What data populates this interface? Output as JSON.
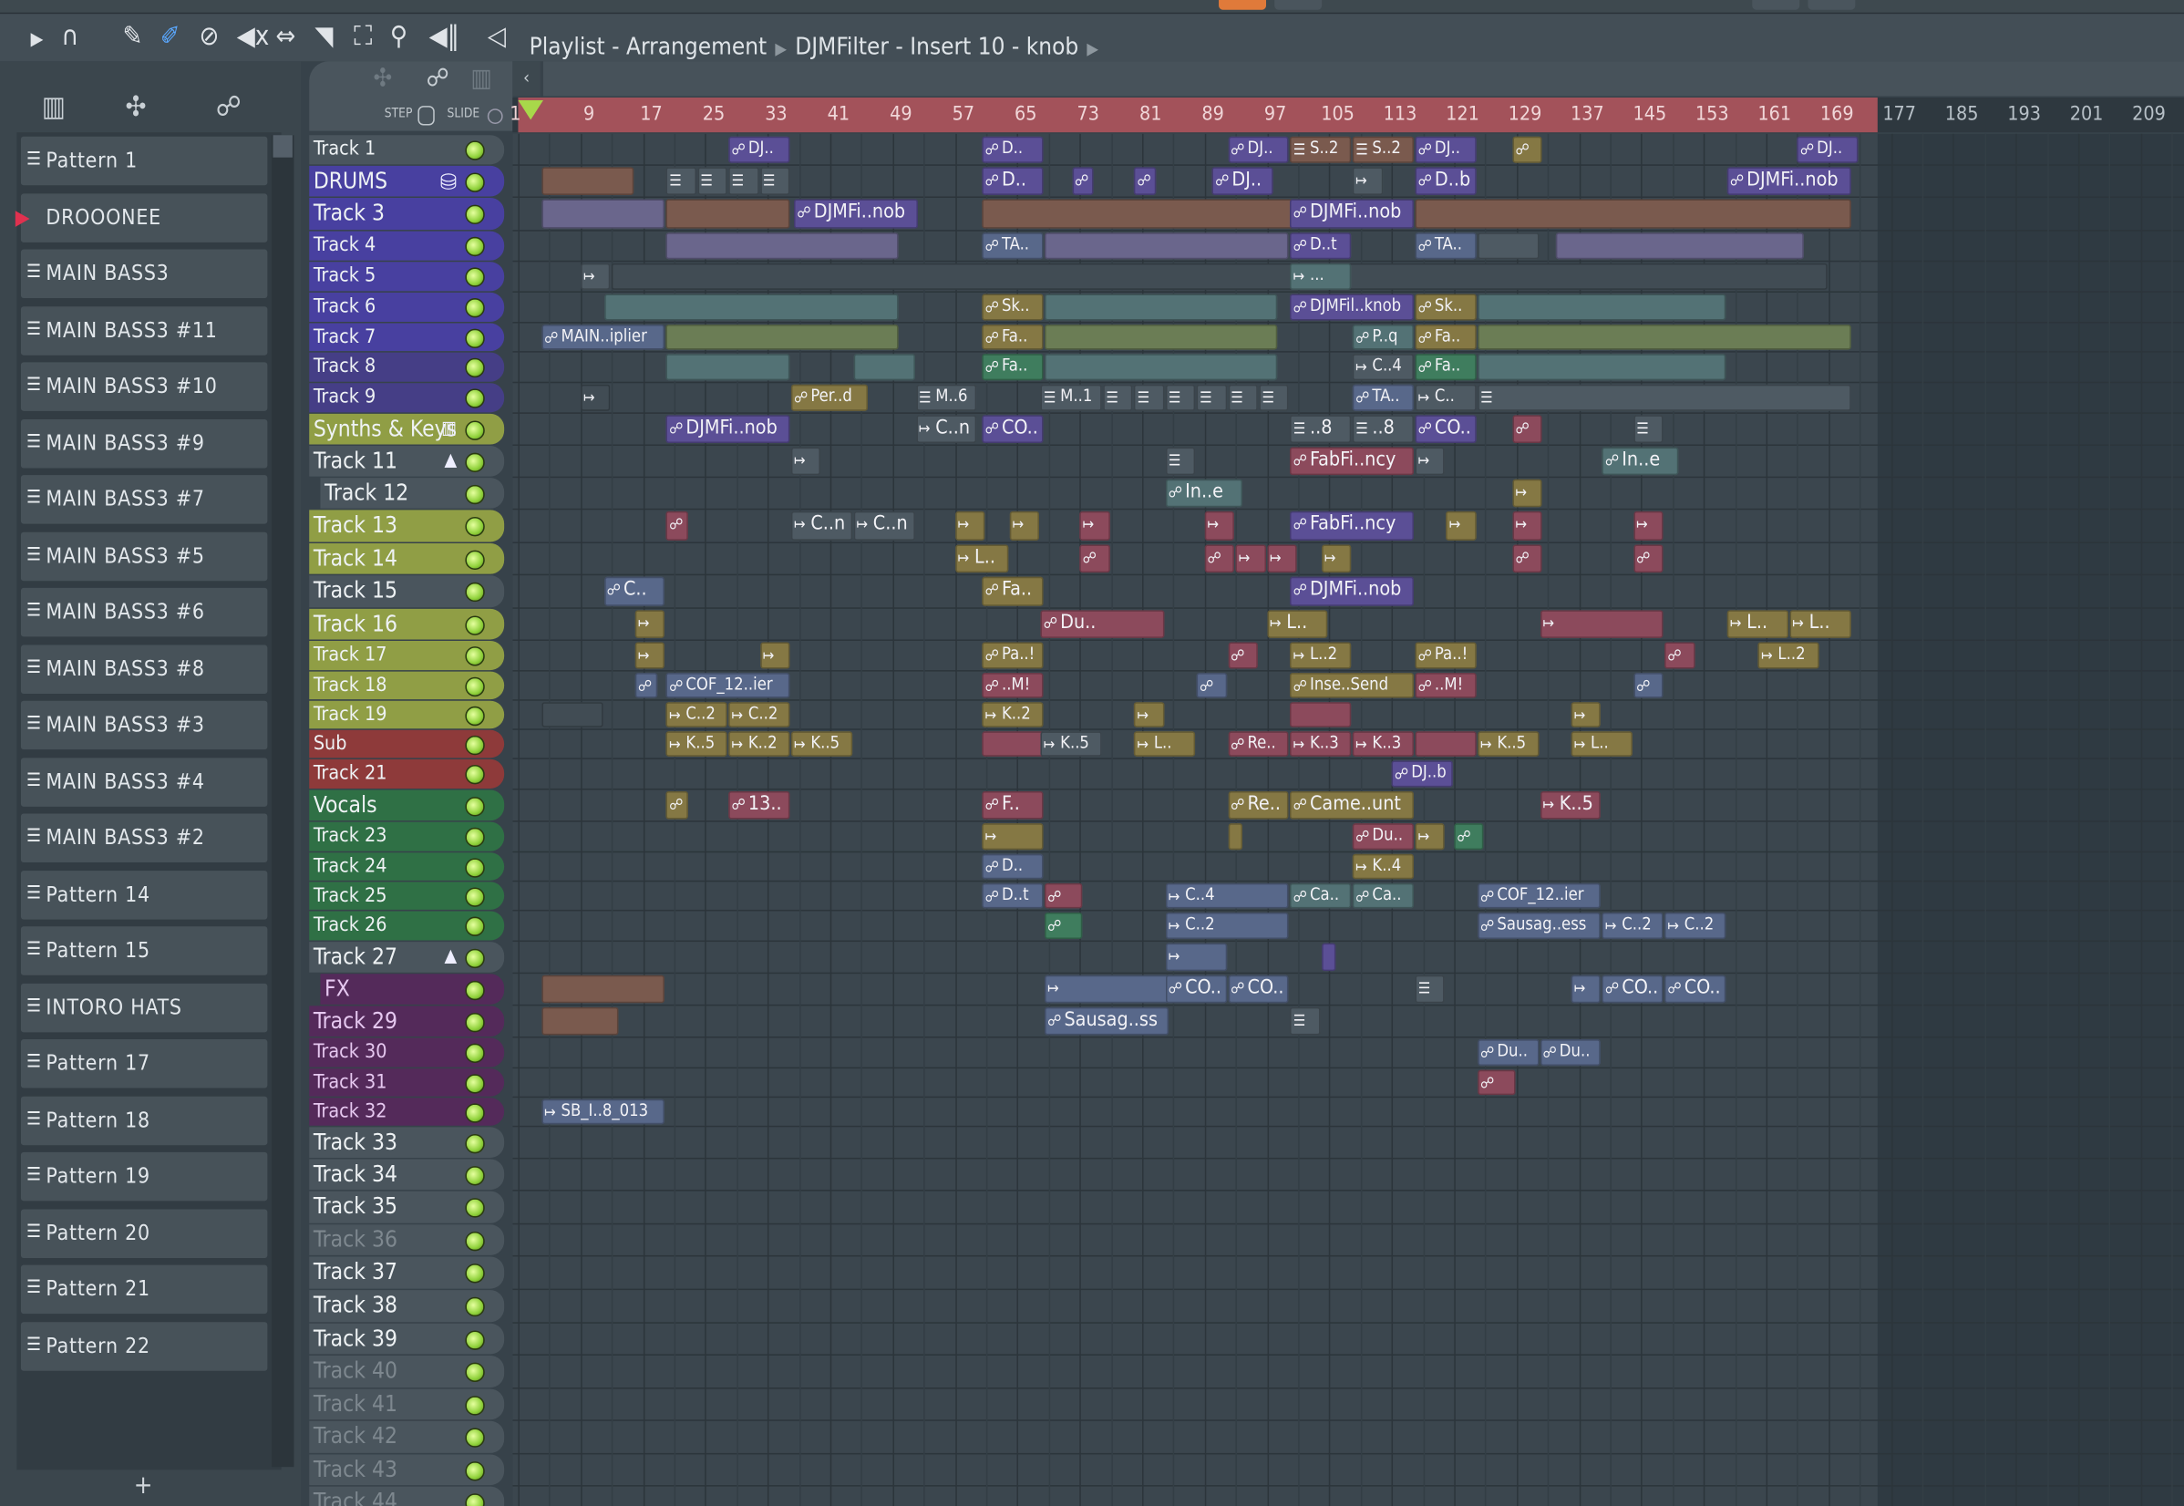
{
  "window": {
    "breadcrumb": [
      "Playlist - Arrangement",
      "DJMFilter - Insert 10 - knob"
    ]
  },
  "toolbar": {
    "icons": [
      "play-arrow-icon",
      "magnet-snap-icon",
      "pencil-icon",
      "paint-brush-icon",
      "delete-icon",
      "mute-icon",
      "slip-icon",
      "slice-icon",
      "select-icon",
      "zoom-icon",
      "playback-icon",
      "speaker-icon"
    ]
  },
  "panel": {
    "step_label": "STEP",
    "slide_label": "SLIDE",
    "add_label": "+"
  },
  "colors": {
    "ruler": "#a3525a",
    "led": "#8fd13a",
    "playhead": "#a8d84a",
    "accent_play": "#e0314f"
  },
  "patterns": [
    "Pattern 1",
    "DROOONEE",
    "MAIN BASS3",
    "MAIN BASS3 #11",
    "MAIN BASS3 #10",
    "MAIN BASS3 #9",
    "MAIN BASS3 #7",
    "MAIN BASS3 #5",
    "MAIN BASS3 #6",
    "MAIN BASS3 #8",
    "MAIN BASS3 #3",
    "MAIN BASS3 #4",
    "MAIN BASS3 #2",
    "Pattern 14",
    "Pattern 15",
    "INTORO HATS",
    "Pattern 17",
    "Pattern 18",
    "Pattern 19",
    "Pattern 20",
    "Pattern 21",
    "Pattern 22"
  ],
  "current_pattern": "DROOONEE",
  "ruler": [
    "1",
    "9",
    "17",
    "25",
    "33",
    "41",
    "49",
    "57",
    "65",
    "73",
    "81",
    "89",
    "97",
    "105",
    "113",
    "121",
    "129",
    "137",
    "145",
    "153",
    "161",
    "169",
    "177",
    "185",
    "193",
    "201",
    "209"
  ],
  "tracks": [
    {
      "name": "Track 1",
      "color": "#4a555d"
    },
    {
      "name": "DRUMS",
      "color": "#4840a0",
      "icon": "drum"
    },
    {
      "name": "Track 3",
      "color": "#4840a0"
    },
    {
      "name": "Track 4",
      "color": "#4840a0"
    },
    {
      "name": "Track 5",
      "color": "#4840a0"
    },
    {
      "name": "Track 6",
      "color": "#4840a0"
    },
    {
      "name": "Track 7",
      "color": "#4840a0"
    },
    {
      "name": "Track 8",
      "color": "#453e86"
    },
    {
      "name": "Track 9",
      "color": "#453e86"
    },
    {
      "name": "Synths & Keys",
      "color": "#909e45",
      "icon": "piano"
    },
    {
      "name": "Track 11",
      "color": "#4a555d",
      "icon": "collapse"
    },
    {
      "name": "Track 12",
      "color": "#4a555d"
    },
    {
      "name": "Track 13",
      "color": "#909e45"
    },
    {
      "name": "Track 14",
      "color": "#909e45"
    },
    {
      "name": "Track 15",
      "color": "#4a555d"
    },
    {
      "name": "Track 16",
      "color": "#909e45"
    },
    {
      "name": "Track 17",
      "color": "#909e45"
    },
    {
      "name": "Track 18",
      "color": "#909e45"
    },
    {
      "name": "Track 19",
      "color": "#909e45"
    },
    {
      "name": "Sub",
      "color": "#8e3a3a"
    },
    {
      "name": "Track 21",
      "color": "#8e3a3a"
    },
    {
      "name": "Vocals",
      "color": "#2f7045"
    },
    {
      "name": "Track 23",
      "color": "#2f7045"
    },
    {
      "name": "Track 24",
      "color": "#2f7045"
    },
    {
      "name": "Track 25",
      "color": "#2f7045"
    },
    {
      "name": "Track 26",
      "color": "#2f7045"
    },
    {
      "name": "Track 27",
      "color": "#4a555d",
      "icon": "collapse"
    },
    {
      "name": "FX",
      "color": "#542a5a"
    },
    {
      "name": "Track 29",
      "color": "#542a5a"
    },
    {
      "name": "Track 30",
      "color": "#542a5a"
    },
    {
      "name": "Track 31",
      "color": "#542a5a"
    },
    {
      "name": "Track 32",
      "color": "#542a5a"
    },
    {
      "name": "Track 33",
      "color": "#4a555d"
    },
    {
      "name": "Track 34",
      "color": "#4a555d"
    },
    {
      "name": "Track 35",
      "color": "#4a555d"
    },
    {
      "name": "Track 36",
      "color": "#4a555d",
      "dim": true
    },
    {
      "name": "Track 37",
      "color": "#4a555d"
    },
    {
      "name": "Track 38",
      "color": "#4a555d"
    },
    {
      "name": "Track 39",
      "color": "#4a555d"
    },
    {
      "name": "Track 40",
      "color": "#4a555d",
      "dim": true
    },
    {
      "name": "Track 41",
      "color": "#4a555d",
      "dim": true
    },
    {
      "name": "Track 42",
      "color": "#4a555d",
      "dim": true
    },
    {
      "name": "Track 43",
      "color": "#4a555d",
      "dim": true
    },
    {
      "name": "Track 44",
      "color": "#4a555d",
      "dim": true
    }
  ],
  "clip_colors": {
    "auto": "#5b4f96",
    "brown": "#7a5a4e",
    "lav": "#6a668c",
    "teal": "#537275",
    "gog": "#6b7d55",
    "olive": "#857844",
    "pink": "#8c4a5c",
    "green": "#3f7d5e",
    "gray": "#4e5a63",
    "slate": "#58688a",
    "dark": "#414c54"
  },
  "clips": [
    [
      0,
      28,
      8,
      "auto",
      "a",
      "DJ.."
    ],
    [
      0,
      60.5,
      8,
      "auto",
      "a",
      "D.."
    ],
    [
      0,
      92,
      8,
      "auto",
      "a",
      "DJ.."
    ],
    [
      0,
      100,
      8,
      "brown",
      "p",
      "S..2"
    ],
    [
      0,
      108,
      8,
      "brown",
      "p",
      "S..2"
    ],
    [
      0,
      116,
      8,
      "auto",
      "a",
      "DJ.."
    ],
    [
      0,
      128.5,
      4,
      "olive",
      "a",
      ""
    ],
    [
      0,
      165,
      8,
      "auto",
      "a",
      "DJ.."
    ],
    [
      1,
      4,
      12,
      "brown",
      "",
      ""
    ],
    [
      1,
      20,
      4,
      "gray",
      "p",
      ""
    ],
    [
      1,
      24,
      4,
      "gray",
      "p",
      ""
    ],
    [
      1,
      28,
      4,
      "gray",
      "p",
      ""
    ],
    [
      1,
      32,
      4,
      "gray",
      "p",
      ""
    ],
    [
      1,
      60.5,
      8,
      "auto",
      "a",
      "D.."
    ],
    [
      1,
      72,
      3,
      "auto",
      "a",
      ""
    ],
    [
      1,
      80,
      3,
      "auto",
      "a",
      ""
    ],
    [
      1,
      90,
      8,
      "auto",
      "a",
      "DJ.."
    ],
    [
      1,
      108,
      4,
      "gray",
      "w",
      ""
    ],
    [
      1,
      116,
      8,
      "auto",
      "a",
      "D..b"
    ],
    [
      1,
      156,
      16,
      "auto",
      "a",
      "DJMFi..nob"
    ],
    [
      2,
      4,
      16,
      "lav",
      "",
      ""
    ],
    [
      2,
      20,
      16,
      "brown",
      "",
      ""
    ],
    [
      2,
      36.4,
      16,
      "auto",
      "a",
      "DJMFi..nob"
    ],
    [
      2,
      60.5,
      40,
      "brown",
      "",
      ""
    ],
    [
      2,
      100,
      16,
      "auto",
      "a",
      "DJMFi..nob"
    ],
    [
      2,
      116,
      56,
      "brown",
      "",
      ""
    ],
    [
      3,
      20,
      30,
      "lav",
      "",
      ""
    ],
    [
      3,
      60.5,
      8,
      "slate",
      "a",
      "TA.."
    ],
    [
      3,
      68.5,
      31.5,
      "lav",
      "",
      ""
    ],
    [
      3,
      100,
      8,
      "auto",
      "a",
      "D..t"
    ],
    [
      3,
      116,
      8,
      "slate",
      "a",
      "TA.."
    ],
    [
      3,
      124,
      8,
      "gray",
      "",
      ""
    ],
    [
      3,
      134,
      32,
      "lav",
      "",
      ""
    ],
    [
      4,
      9,
      4,
      "gray",
      "w",
      ""
    ],
    [
      4,
      13,
      156,
      "dark",
      "",
      ""
    ],
    [
      4,
      100,
      8,
      "teal",
      "w",
      "..."
    ],
    [
      5,
      12,
      38,
      "teal",
      "",
      ""
    ],
    [
      5,
      60.5,
      8,
      "olive",
      "a",
      "Sk.."
    ],
    [
      5,
      68.5,
      30,
      "teal",
      "",
      ""
    ],
    [
      5,
      100,
      16,
      "auto",
      "a",
      "DJMFil..knob"
    ],
    [
      5,
      116,
      8,
      "olive",
      "a",
      "Sk.."
    ],
    [
      5,
      124,
      32,
      "teal",
      "",
      ""
    ],
    [
      6,
      4,
      16,
      "slate",
      "a",
      "MAIN..iplier"
    ],
    [
      6,
      20,
      30,
      "gog",
      "",
      ""
    ],
    [
      6,
      60.5,
      8,
      "olive",
      "a",
      "Fa.."
    ],
    [
      6,
      68.5,
      30,
      "gog",
      "",
      ""
    ],
    [
      6,
      108,
      8,
      "teal",
      "a",
      "P..q"
    ],
    [
      6,
      116,
      8,
      "olive",
      "a",
      "Fa.."
    ],
    [
      6,
      124,
      48,
      "gog",
      "",
      ""
    ],
    [
      7,
      20,
      16,
      "teal",
      "",
      ""
    ],
    [
      7,
      44,
      8,
      "teal",
      "",
      ""
    ],
    [
      7,
      60.5,
      8,
      "green",
      "a",
      "Fa.."
    ],
    [
      7,
      68.5,
      30,
      "teal",
      "",
      ""
    ],
    [
      7,
      108,
      8,
      "gray",
      "w",
      "C..4"
    ],
    [
      7,
      116,
      8,
      "green",
      "a",
      "Fa.."
    ],
    [
      7,
      124,
      32,
      "teal",
      "",
      ""
    ],
    [
      8,
      9,
      4,
      "dark",
      "w",
      ""
    ],
    [
      8,
      36,
      10,
      "olive",
      "a",
      "Per..d"
    ],
    [
      8,
      52,
      8,
      "gray",
      "p",
      "M..6"
    ],
    [
      8,
      68,
      8,
      "gray",
      "p",
      "M..1"
    ],
    [
      8,
      76,
      4,
      "gray",
      "p",
      ""
    ],
    [
      8,
      80,
      4,
      "gray",
      "p",
      ""
    ],
    [
      8,
      84,
      4,
      "gray",
      "p",
      ""
    ],
    [
      8,
      88,
      4,
      "gray",
      "p",
      ""
    ],
    [
      8,
      92,
      4,
      "gray",
      "p",
      ""
    ],
    [
      8,
      96,
      4,
      "gray",
      "p",
      ""
    ],
    [
      8,
      108,
      8,
      "slate",
      "a",
      "TA.."
    ],
    [
      8,
      116,
      8,
      "gray",
      "w",
      "C.."
    ],
    [
      8,
      124,
      48,
      "gray",
      "p",
      ""
    ],
    [
      9,
      20,
      16,
      "auto",
      "a",
      "DJMFi..nob"
    ],
    [
      9,
      52,
      8,
      "gray",
      "w",
      "C..n"
    ],
    [
      9,
      60.5,
      8,
      "auto",
      "a",
      "CO.."
    ],
    [
      9,
      100,
      8,
      "gray",
      "p",
      "..8"
    ],
    [
      9,
      108,
      8,
      "gray",
      "p",
      "..8"
    ],
    [
      9,
      116,
      8,
      "auto",
      "a",
      "CO.."
    ],
    [
      9,
      128.5,
      4,
      "pink",
      "a",
      ""
    ],
    [
      9,
      144,
      4,
      "gray",
      "p",
      ""
    ],
    [
      10,
      36,
      4,
      "gray",
      "w",
      ""
    ],
    [
      10,
      84,
      4,
      "gray",
      "p",
      ""
    ],
    [
      10,
      100,
      16,
      "pink",
      "a",
      "FabFi..ncy"
    ],
    [
      10,
      116,
      4,
      "gray",
      "w",
      ""
    ],
    [
      10,
      140,
      10,
      "teal",
      "a",
      "In..e"
    ],
    [
      11,
      84,
      10,
      "teal",
      "a",
      "In..e"
    ],
    [
      11,
      128.5,
      4,
      "olive",
      "w",
      ""
    ],
    [
      12,
      20,
      3,
      "pink",
      "a",
      ""
    ],
    [
      12,
      36,
      8,
      "gray",
      "w",
      "C..n"
    ],
    [
      12,
      44,
      8,
      "gray",
      "w",
      "C..n"
    ],
    [
      12,
      57,
      4,
      "olive",
      "w",
      ""
    ],
    [
      12,
      64,
      4,
      "olive",
      "w",
      ""
    ],
    [
      12,
      73,
      4,
      "pink",
      "w",
      ""
    ],
    [
      12,
      89,
      4,
      "pink",
      "w",
      ""
    ],
    [
      12,
      100,
      16,
      "auto",
      "a",
      "FabFi..ncy"
    ],
    [
      12,
      120,
      4,
      "olive",
      "w",
      ""
    ],
    [
      12,
      128.5,
      4,
      "pink",
      "w",
      ""
    ],
    [
      12,
      144,
      4,
      "pink",
      "w",
      ""
    ],
    [
      13,
      57,
      7,
      "olive",
      "w",
      "L.."
    ],
    [
      13,
      73,
      4,
      "pink",
      "a",
      ""
    ],
    [
      13,
      89,
      4,
      "pink",
      "a",
      ""
    ],
    [
      13,
      93,
      4,
      "pink",
      "w",
      ""
    ],
    [
      13,
      97,
      4,
      "pink",
      "w",
      ""
    ],
    [
      13,
      104,
      4,
      "olive",
      "w",
      ""
    ],
    [
      13,
      128.5,
      4,
      "pink",
      "a",
      ""
    ],
    [
      13,
      144,
      4,
      "pink",
      "a",
      ""
    ],
    [
      14,
      12,
      8,
      "slate",
      "a",
      "C.."
    ],
    [
      14,
      60.5,
      8,
      "olive",
      "a",
      "Fa.."
    ],
    [
      14,
      100,
      16,
      "auto",
      "a",
      "DJMFi..nob"
    ],
    [
      15,
      16,
      4,
      "olive",
      "w",
      ""
    ],
    [
      15,
      68,
      16,
      "pink",
      "a",
      "Du.."
    ],
    [
      15,
      97,
      8,
      "olive",
      "w",
      "L.."
    ],
    [
      15,
      132,
      16,
      "pink",
      "w",
      ""
    ],
    [
      15,
      156,
      8,
      "olive",
      "w",
      "L.."
    ],
    [
      15,
      164,
      8,
      "olive",
      "w",
      "L.."
    ],
    [
      16,
      16,
      4,
      "olive",
      "w",
      ""
    ],
    [
      16,
      32,
      4,
      "olive",
      "w",
      ""
    ],
    [
      16,
      60.5,
      8,
      "olive",
      "a",
      "Pa..!"
    ],
    [
      16,
      92,
      4,
      "pink",
      "a",
      ""
    ],
    [
      16,
      100,
      8,
      "olive",
      "w",
      "L..2"
    ],
    [
      16,
      116,
      8,
      "olive",
      "a",
      "Pa..!"
    ],
    [
      16,
      148,
      4,
      "pink",
      "a",
      ""
    ],
    [
      16,
      160,
      8,
      "olive",
      "w",
      "L..2"
    ],
    [
      17,
      16,
      3,
      "slate",
      "a",
      ""
    ],
    [
      17,
      20,
      16,
      "slate",
      "a",
      "COF_12..ier"
    ],
    [
      17,
      60.5,
      8,
      "pink",
      "a",
      "..M!"
    ],
    [
      17,
      88,
      4,
      "slate",
      "a",
      ""
    ],
    [
      17,
      100,
      16,
      "olive",
      "a",
      "Inse..Send"
    ],
    [
      17,
      116,
      8,
      "pink",
      "a",
      "..M!"
    ],
    [
      17,
      144,
      4,
      "slate",
      "a",
      ""
    ],
    [
      18,
      4,
      8,
      "dark",
      "",
      ""
    ],
    [
      18,
      20,
      8,
      "olive",
      "w",
      "C..2"
    ],
    [
      18,
      28,
      8,
      "olive",
      "w",
      "C..2"
    ],
    [
      18,
      60.5,
      8,
      "olive",
      "w",
      "K..2"
    ],
    [
      18,
      80,
      4,
      "olive",
      "w",
      ""
    ],
    [
      18,
      100,
      8,
      "pink",
      "",
      ""
    ],
    [
      18,
      136,
      4,
      "olive",
      "w",
      ""
    ],
    [
      19,
      20,
      8,
      "olive",
      "w",
      "K..5"
    ],
    [
      19,
      28,
      8,
      "olive",
      "w",
      "K..2"
    ],
    [
      19,
      36,
      8,
      "olive",
      "w",
      "K..5"
    ],
    [
      19,
      60.5,
      8,
      "pink",
      "",
      ""
    ],
    [
      19,
      68,
      8,
      "gray",
      "w",
      "K..5"
    ],
    [
      19,
      80,
      8,
      "olive",
      "w",
      "L.."
    ],
    [
      19,
      92,
      8,
      "pink",
      "a",
      "Re.."
    ],
    [
      19,
      100,
      8,
      "pink",
      "w",
      "K..3"
    ],
    [
      19,
      108,
      8,
      "pink",
      "w",
      "K..3"
    ],
    [
      19,
      116,
      8,
      "pink",
      "",
      ""
    ],
    [
      19,
      124,
      8,
      "olive",
      "w",
      "K..5"
    ],
    [
      19,
      136,
      8,
      "olive",
      "w",
      "L.."
    ],
    [
      20,
      113,
      8,
      "auto",
      "a",
      "DJ..b"
    ],
    [
      21,
      20,
      3,
      "olive",
      "a",
      ""
    ],
    [
      21,
      28,
      8,
      "pink",
      "a",
      "13.."
    ],
    [
      21,
      60.5,
      8,
      "pink",
      "a",
      "F.."
    ],
    [
      21,
      92,
      8,
      "olive",
      "a",
      "Re.."
    ],
    [
      21,
      100,
      16,
      "olive",
      "a",
      "Came..unt"
    ],
    [
      21,
      132,
      8,
      "pink",
      "w",
      "K..5"
    ],
    [
      22,
      60.5,
      8,
      "olive",
      "w",
      ""
    ],
    [
      22,
      92,
      2,
      "olive",
      "",
      ""
    ],
    [
      22,
      108,
      8,
      "pink",
      "a",
      "Du.."
    ],
    [
      22,
      116,
      4,
      "olive",
      "w",
      ""
    ],
    [
      22,
      121,
      4,
      "green",
      "a",
      ""
    ],
    [
      23,
      60.5,
      8,
      "slate",
      "a",
      "D.."
    ],
    [
      23,
      108,
      8,
      "olive",
      "w",
      "K..4"
    ],
    [
      24,
      60.5,
      8,
      "slate",
      "a",
      "D..t"
    ],
    [
      24,
      68.5,
      5,
      "pink",
      "a",
      ""
    ],
    [
      24,
      84,
      16,
      "slate",
      "w",
      "C..4"
    ],
    [
      24,
      100,
      8,
      "teal",
      "a",
      "Ca.."
    ],
    [
      24,
      108,
      8,
      "teal",
      "a",
      "Ca.."
    ],
    [
      24,
      124,
      16,
      "slate",
      "a",
      "COF_12..ier"
    ],
    [
      25,
      68.5,
      5,
      "green",
      "a",
      ""
    ],
    [
      25,
      84,
      16,
      "slate",
      "w",
      "C..2"
    ],
    [
      25,
      124,
      16,
      "slate",
      "a",
      "Sausag..ess"
    ],
    [
      25,
      140,
      8,
      "slate",
      "w",
      "C..2"
    ],
    [
      25,
      148,
      8,
      "slate",
      "w",
      "C..2"
    ],
    [
      26,
      84,
      8,
      "slate",
      "w",
      ""
    ],
    [
      26,
      104,
      2,
      "auto",
      "",
      ""
    ],
    [
      27,
      4,
      16,
      "brown",
      "",
      ""
    ],
    [
      27,
      68.5,
      16,
      "slate",
      "w",
      ""
    ],
    [
      27,
      84,
      8,
      "slate",
      "a",
      "CO.."
    ],
    [
      27,
      92,
      8,
      "slate",
      "a",
      "CO.."
    ],
    [
      27,
      116,
      4,
      "gray",
      "p",
      ""
    ],
    [
      27,
      136,
      4,
      "slate",
      "w",
      ""
    ],
    [
      27,
      140,
      8,
      "slate",
      "a",
      "CO.."
    ],
    [
      27,
      148,
      8,
      "slate",
      "a",
      "CO.."
    ],
    [
      28,
      4,
      10,
      "brown",
      "",
      ""
    ],
    [
      28,
      68.5,
      16,
      "slate",
      "a",
      "Sausag..ss"
    ],
    [
      28,
      100,
      4,
      "gray",
      "p",
      ""
    ],
    [
      29,
      124,
      8,
      "slate",
      "a",
      "Du.."
    ],
    [
      29,
      132,
      8,
      "slate",
      "a",
      "Du.."
    ],
    [
      30,
      124,
      5,
      "pink",
      "a",
      ""
    ],
    [
      31,
      4,
      16,
      "slate",
      "w",
      "SB_I..8_013"
    ]
  ]
}
